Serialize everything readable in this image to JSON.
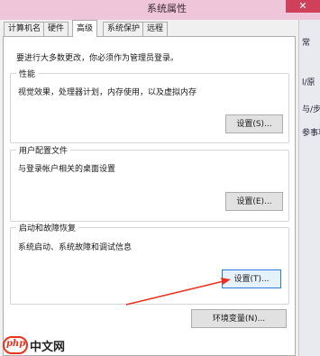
{
  "window": {
    "title": "系统属性",
    "close_glyph": "✕"
  },
  "tabs": [
    {
      "label": "计算机名"
    },
    {
      "label": "硬件"
    },
    {
      "label": "高级",
      "active": true
    },
    {
      "label": "系统保护"
    },
    {
      "label": "远程"
    }
  ],
  "panel": {
    "admin_note": "要进行大多数更改，你必须作为管理员登录。"
  },
  "groups": {
    "performance": {
      "title": "性能",
      "description": "视觉效果，处理器计划，内存使用，以及虚拟内存",
      "button": "设置(S)..."
    },
    "user_profiles": {
      "title": "用户配置文件",
      "description": "与登录帐户相关的桌面设置",
      "button": "设置(E)..."
    },
    "startup_recovery": {
      "title": "启动和故障恢复",
      "description": "系统启动、系统故障和调试信息",
      "button": "设置(T)..."
    }
  },
  "env_button": "环境变量(N)...",
  "background_window": {
    "fragments": [
      "常",
      "l/原",
      "与/步",
      "参事项"
    ]
  },
  "watermark": {
    "badge": "php",
    "text": "中文网"
  },
  "colors": {
    "titlebar": "#efc6d9",
    "close": "#d0405a",
    "annotation_arrow": "#e8321e",
    "focus": "#2b7bd8"
  }
}
